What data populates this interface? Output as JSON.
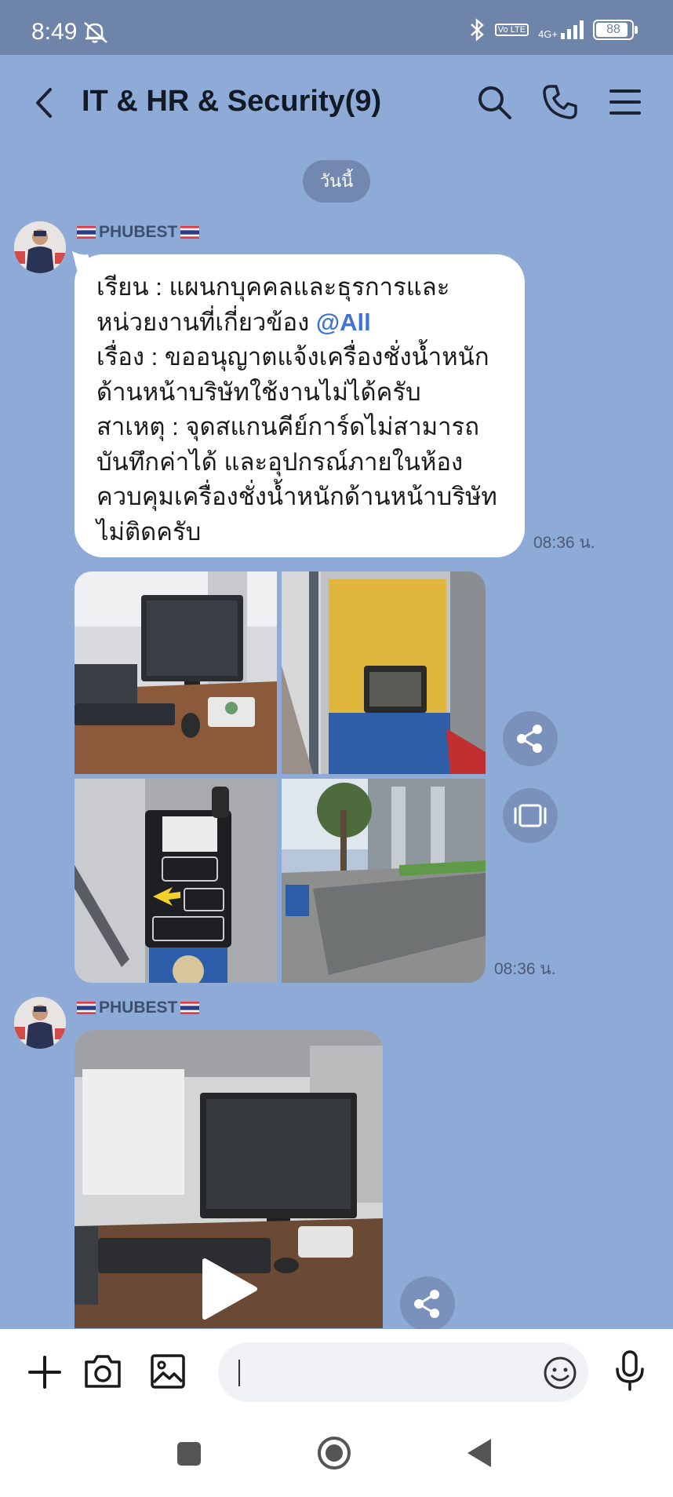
{
  "status_bar": {
    "time": "8:49",
    "volte": "Vo LTE",
    "network": "4G+",
    "battery": "88"
  },
  "header": {
    "title": "IT & HR & Security(9)"
  },
  "date_divider": "วันนี้",
  "messages": [
    {
      "sender": "PHUBEST",
      "text_before_mention": "เรียน : แผนกบุคคลและธุรการและ\nหน่วยงานที่เกี่ยวข้อง ",
      "mention": "@All",
      "text_after_mention": "\nเรื่อง : ขออนุญาตแจ้งเครื่องชั่งน้ำหนัก\nด้านหน้าบริษัทใช้งานไม่ได้ครับ\nสาเหตุ : จุดสแกนคีย์การ์ดไม่สามารถ\nบันทึกค่าได้ และอุปกรณ์ภายในห้อง\nควบคุมเครื่องชั่งน้ำหนักด้านหน้าบริษัท\nไม่ติดครับ",
      "time": "08:36 น."
    },
    {
      "type": "photo-grid",
      "photos": [
        "computer-monitor-desk",
        "yellow-card-reader-booth",
        "card-scanner-panel",
        "weighbridge-road"
      ],
      "time": "08:36 น."
    },
    {
      "sender": "PHUBEST",
      "type": "video"
    }
  ],
  "composer": {
    "placeholder": ""
  },
  "colors": {
    "background": "#8eabd8",
    "status_bar": "#6e84a8",
    "mention": "#3e75d2",
    "bubble": "#ffffff"
  }
}
